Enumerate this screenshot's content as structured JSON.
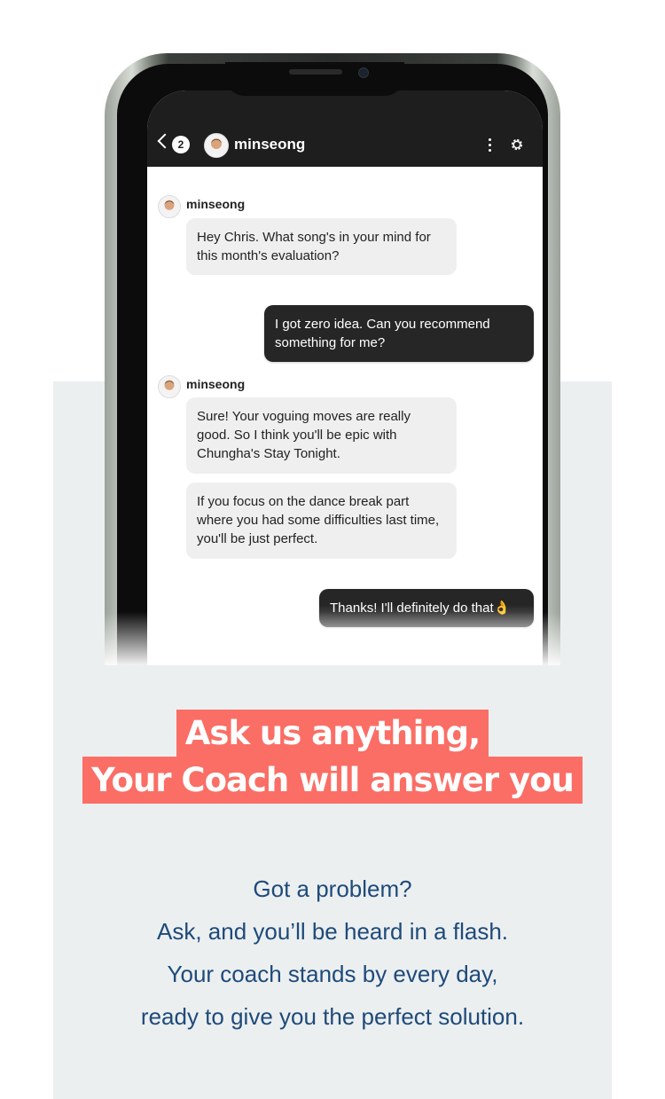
{
  "chat": {
    "header": {
      "unread_count": "2",
      "contact_name": "minseong"
    },
    "messages": [
      {
        "sender": "minseong",
        "text": "Hey Chris. What song's in your mind for this month's evaluation?"
      },
      {
        "text": "I got zero idea. Can you recommend something for me?"
      },
      {
        "sender": "minseong",
        "text": "Sure! Your voguing moves are really good. So I think you'll be epic with Chungha's Stay Tonight."
      },
      {
        "text": "If you focus on the dance break part where you had some difficulties last time, you'll be just perfect."
      },
      {
        "text": "Thanks! I'll definitely do that👌"
      }
    ]
  },
  "headline": {
    "line1": "Ask us anything,",
    "line2": "Your Coach will answer you"
  },
  "body": {
    "line1": "Got a problem?",
    "line2": "Ask, and you’ll be heard in a flash.",
    "line3": "Your coach stands by every day,",
    "line4": "ready to give you the perfect solution."
  },
  "colors": {
    "headline_bg": "#fa6e65",
    "body_text": "#1e4a7a",
    "chat_header": "#1e1e1e",
    "incoming_bubble": "#efefef",
    "outgoing_bubble": "#262626"
  }
}
